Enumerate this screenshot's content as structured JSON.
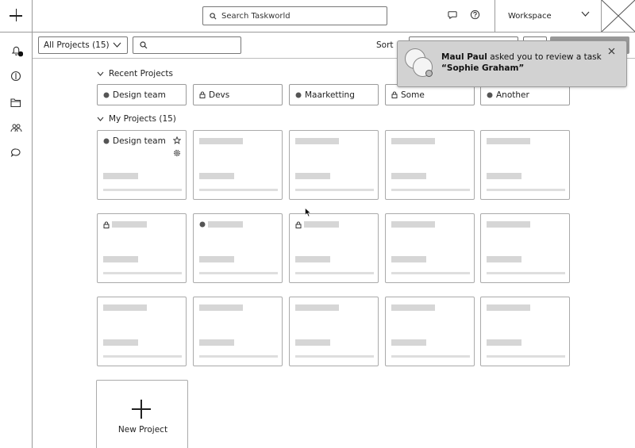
{
  "topbar": {
    "search_placeholder": "Search Taskworld",
    "workspace_label": "Workspace"
  },
  "filterbar": {
    "project_filter": "All Projects (15)",
    "sort_label": "Sort"
  },
  "recent": {
    "heading": "Recent Projects",
    "items": [
      {
        "label": "Design team",
        "icon": "globe-icon"
      },
      {
        "label": "Devs",
        "icon": "lock-icon"
      },
      {
        "label": "Maarketting",
        "icon": "globe-icon"
      },
      {
        "label": "Some",
        "icon": "lock-icon"
      },
      {
        "label": "Another",
        "icon": "globe-icon"
      }
    ]
  },
  "my_projects": {
    "heading": "My Projects (15)",
    "first_card_title": "Design team"
  },
  "new_project": {
    "label": "New Project"
  },
  "notification": {
    "actor": "Maul Paul",
    "message": "asked you to review a task",
    "task": "“Sophie Graham”"
  }
}
